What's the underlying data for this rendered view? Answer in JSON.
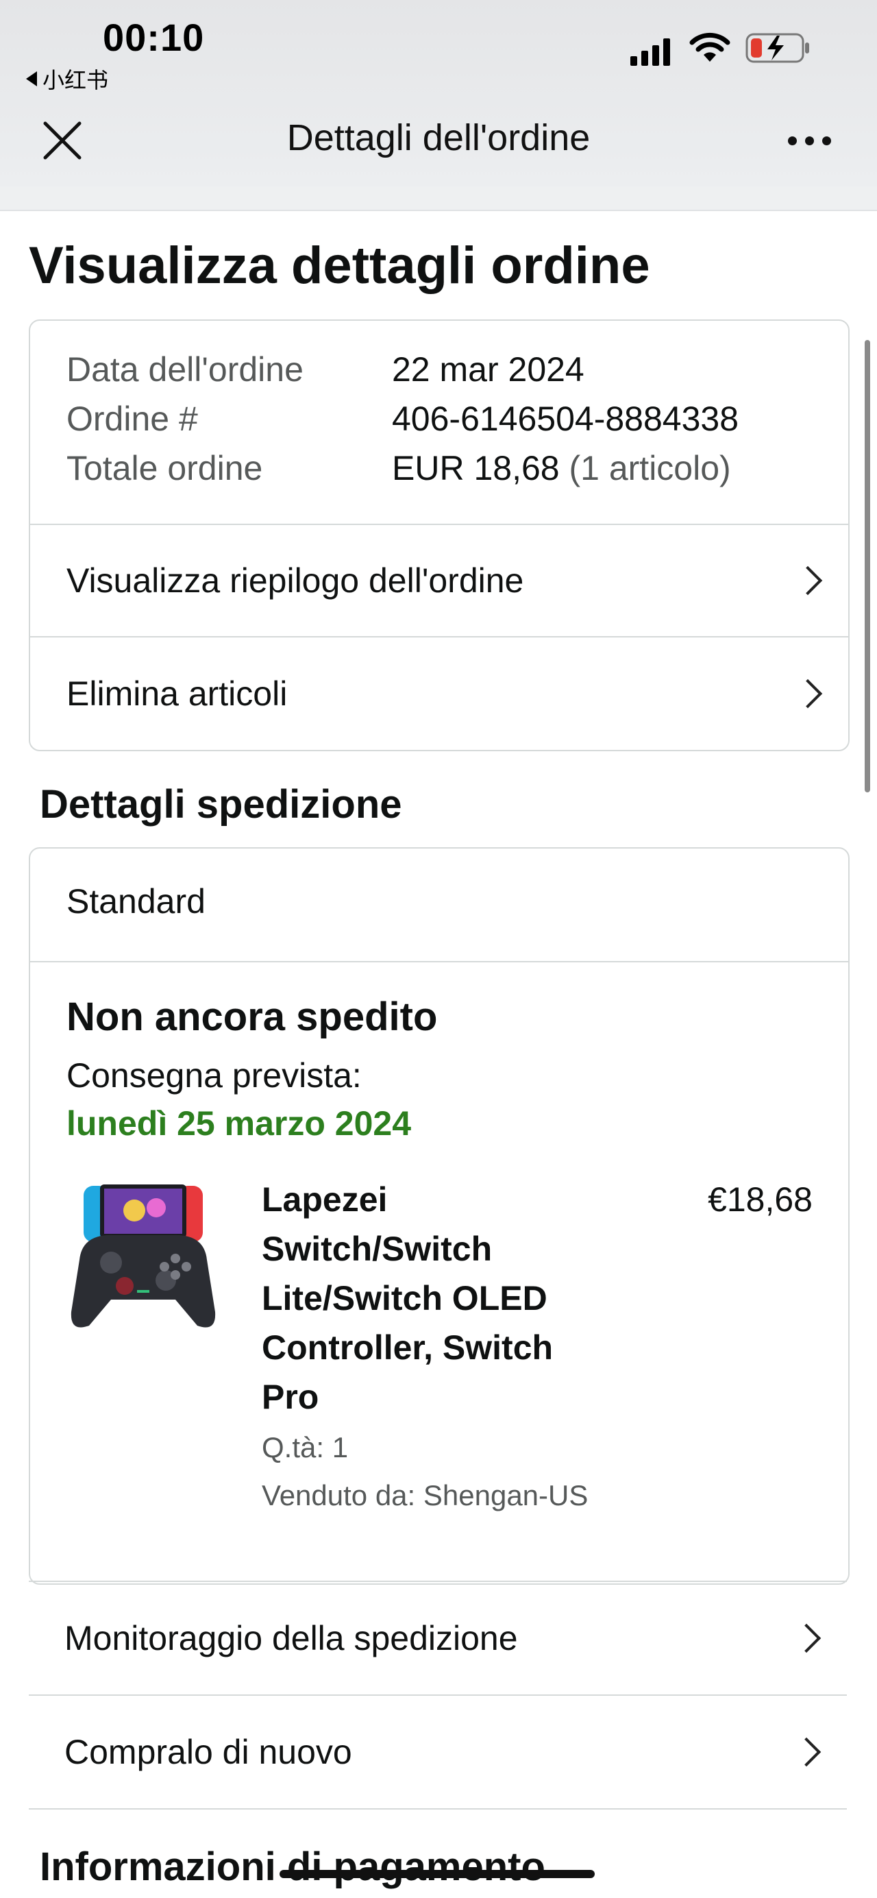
{
  "status_bar": {
    "time": "00:10",
    "back_app": "小红书"
  },
  "nav": {
    "title": "Dettagli dell'ordine"
  },
  "page": {
    "title": "Visualizza dettagli ordine"
  },
  "order_summary": {
    "date_label": "Data dell'ordine",
    "date_value": "22 mar 2024",
    "number_label": "Ordine #",
    "number_value": "406-6146504-8884338",
    "total_label": "Totale ordine",
    "total_value": "EUR 18,68",
    "total_items": "(1 articolo)",
    "links": [
      {
        "label": "Visualizza riepilogo dell'ordine"
      },
      {
        "label": "Elimina articoli"
      }
    ]
  },
  "shipping": {
    "section_title": "Dettagli spedizione",
    "method": "Standard",
    "status": "Non ancora spedito",
    "eta_label": "Consegna prevista:",
    "eta_date": "lunedì 25 marzo 2024",
    "eta_color": "#2c7f1e",
    "product": {
      "title": "Lapezei Switch/Switch Lite/Switch OLED Controller, Switch Pro",
      "price": "€18,68",
      "quantity": "Q.tà: 1",
      "seller": "Venduto da: Shengan-US",
      "image_icon": "game-controller-image"
    }
  },
  "actions": [
    {
      "label": "Monitoraggio della spedizione"
    },
    {
      "label": "Compralo di nuovo"
    }
  ],
  "payment": {
    "section_title": "Informazioni di pagamento"
  }
}
